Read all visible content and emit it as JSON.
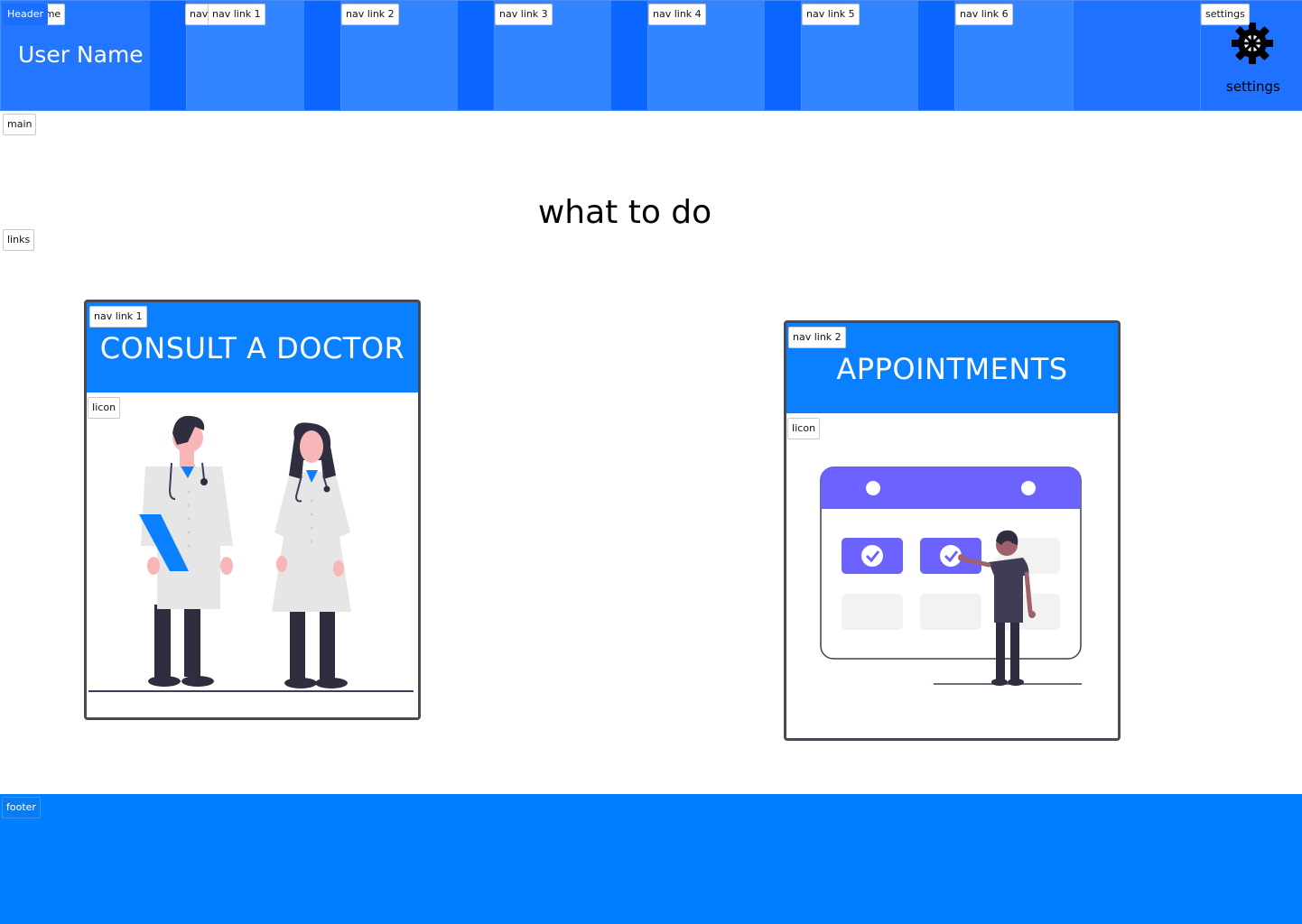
{
  "header": {
    "tag": "Header",
    "name_tag": "name",
    "user_name": "User Name",
    "nav_tag": "nav",
    "nav_links": [
      "nav link 1",
      "nav link 2",
      "nav link 3",
      "nav link 4",
      "nav link 5",
      "nav link 6"
    ],
    "settings_tag": "settings",
    "settings_label": "settings",
    "settings_icon": "gear-icon"
  },
  "main": {
    "tag": "main",
    "title": "what to do",
    "links_tag": "links",
    "cards": [
      {
        "tag": "nav link 1",
        "title": "CONSULT A DOCTOR",
        "icon_tag": "Iicon",
        "illustration": "doctors-illustration"
      },
      {
        "tag": "nav link 2",
        "title": "APPOINTMENTS",
        "icon_tag": "Iicon",
        "illustration": "calendar-appointments-illustration"
      }
    ]
  },
  "footer": {
    "tag": "footer"
  },
  "colors": {
    "header": "#1f72ff",
    "accent": "#0a80ff",
    "footer": "#0080ff",
    "illustration_purple": "#6c63ff"
  }
}
